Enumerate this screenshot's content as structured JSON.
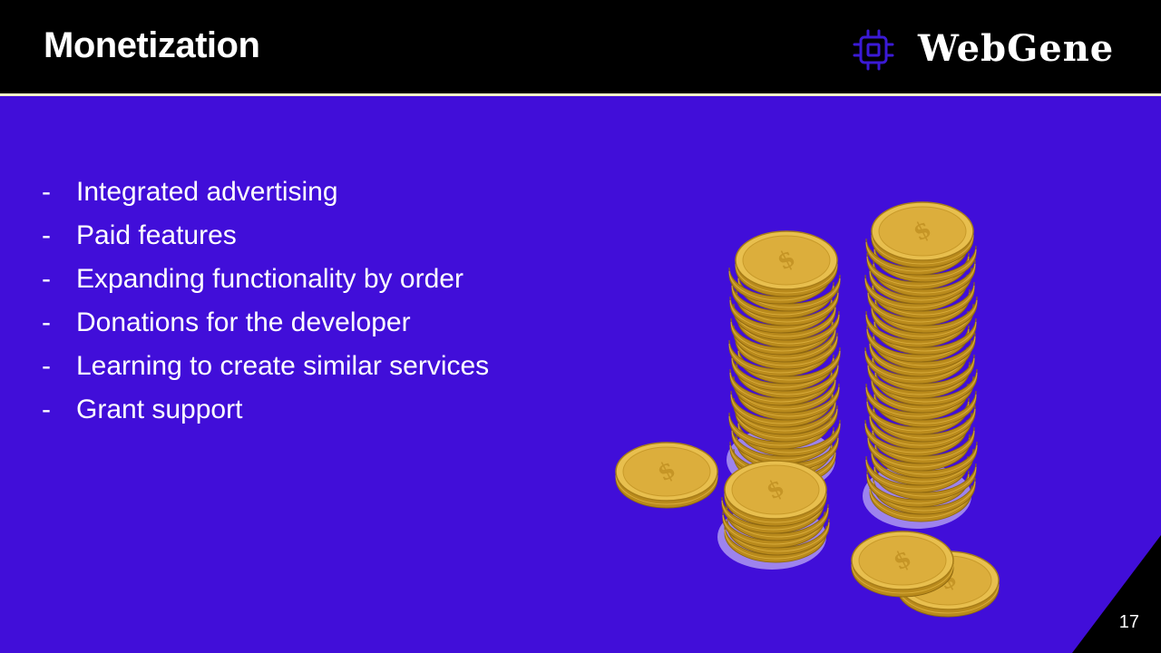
{
  "slide": {
    "title": "Monetization",
    "page_number": "17"
  },
  "logo": {
    "text": "WebGene",
    "icon": "chip-icon",
    "icon_color": "#3b1ad6"
  },
  "bullets": [
    {
      "dash": "-",
      "text": "Integrated advertising"
    },
    {
      "dash": "-",
      "text": "Paid features"
    },
    {
      "dash": "-",
      "text": "Expanding functionality by order"
    },
    {
      "dash": "-",
      "text": "Donations for the developer"
    },
    {
      "dash": "-",
      "text": "Learning to create similar services"
    },
    {
      "dash": "-",
      "text": "Grant support"
    }
  ],
  "illustration": {
    "subject": "stacks-of-gold-coins"
  },
  "colors": {
    "background": "#410ed9",
    "header": "#000000",
    "header_rule": "#f4f1c8",
    "coin_gold": "#e0b84a"
  }
}
